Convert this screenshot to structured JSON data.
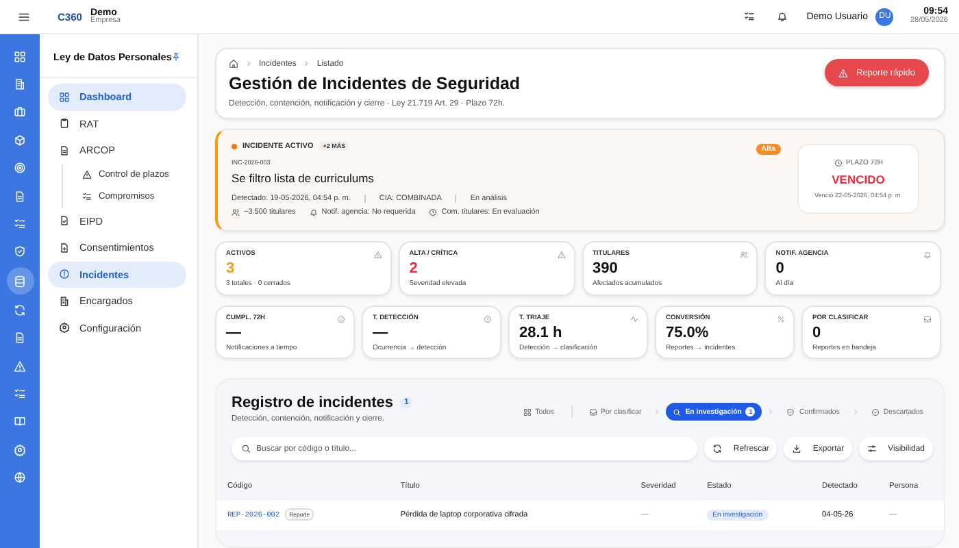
{
  "topbar": {
    "logo": "C360",
    "company": "Demo",
    "company_sub": "Empresa",
    "user": "Demo Usuario",
    "avatar": "DU",
    "time": "09:54",
    "date": "28/05/2026"
  },
  "rail": [
    {
      "selected": false
    },
    {
      "selected": false
    },
    {
      "selected": false
    },
    {
      "selected": false
    },
    {
      "selected": false
    },
    {
      "selected": false
    },
    {
      "selected": false
    },
    {
      "selected": false
    },
    {
      "selected": true
    },
    {
      "selected": false
    },
    {
      "selected": false
    },
    {
      "selected": false
    },
    {
      "selected": false
    },
    {
      "selected": false
    },
    {
      "selected": false
    },
    {
      "selected": false
    }
  ],
  "sidebar": {
    "title": "Ley de Datos Personales",
    "items": [
      {
        "label": "Dashboard",
        "selected": true
      },
      {
        "label": "RAT",
        "selected": false
      },
      {
        "label": "ARCOP",
        "selected": false,
        "children": [
          {
            "label": "Control de plazos",
            "selected": false
          },
          {
            "label": "Compromisos",
            "selected": false
          }
        ]
      },
      {
        "label": "EIPD",
        "selected": false
      },
      {
        "label": "Consentimientos",
        "selected": false
      },
      {
        "label": "Incidentes",
        "selected": true
      },
      {
        "label": "Encargados",
        "selected": false
      },
      {
        "label": "Configuración",
        "selected": false
      }
    ]
  },
  "header": {
    "breadcrumb": [
      "Incidentes",
      "Listado"
    ],
    "title": "Gestión de Incidentes de Seguridad",
    "subtitle": "Detección, contención, notificación y cierre · Ley 21.719 Art. 29 · Plazo 72h.",
    "action": "Reporte rápido"
  },
  "incident": {
    "status": "INCIDENTE ACTIVO",
    "more": "+2 MÁS",
    "code": "INC-2026-003",
    "title": "Se filtro lista de curriculums",
    "meta": [
      "Detectado: 19-05-2026, 04:54 p. m.",
      "CIA: COMBINADA",
      "En análisis"
    ],
    "facts": [
      "~3.500 titulares",
      "Notif. agencia: No requerida",
      "Com. titulares: En evaluación"
    ],
    "severity": "Alta",
    "deadline": {
      "label": "PLAZO 72H",
      "state": "VENCIDO",
      "note": "Venció 22-05-2026, 04:54 p. m."
    }
  },
  "stats": [
    {
      "label": "ACTIVOS",
      "value": "3",
      "note": "3 totales · 0 cerrados",
      "color": "#f59e0b"
    },
    {
      "label": "ALTA / CRÍTICA",
      "value": "2",
      "note": "Severidad elevada",
      "color": "#ef2b3c"
    },
    {
      "label": "TITULARES",
      "value": "390",
      "note": "Afectados acumulados",
      "color": "#111111"
    },
    {
      "label": "NOTIF. AGENCIA",
      "value": "0",
      "note": "Al día",
      "color": "#111111"
    },
    {
      "label": "CUMPL. 72H",
      "value": "—",
      "note": "Notificaciones a tiempo",
      "color": "#111111"
    },
    {
      "label": "T. DETECCIÓN",
      "value": "—",
      "note": "Ocurrencia → detección",
      "color": "#111111"
    },
    {
      "label": "T. TRIAJE",
      "value": "28.1 h",
      "note": "Detección → clasificación",
      "color": "#111111"
    },
    {
      "label": "CONVERSIÓN",
      "value": "75.0%",
      "note": "Reportes → incidentes",
      "color": "#111111"
    },
    {
      "label": "POR CLASIFICAR",
      "value": "0",
      "note": "Reportes en bandeja",
      "color": "#111111"
    }
  ],
  "registry": {
    "title": "Registro de incidentes",
    "count": "1",
    "subtitle": "Detección, contención, notificación y cierre.",
    "filters": [
      {
        "label": "Todos",
        "selected": false
      },
      {
        "label": "Por clasificar",
        "selected": false
      },
      {
        "label": "En investigación",
        "count": "1",
        "selected": true
      },
      {
        "label": "Confirmados",
        "selected": false
      },
      {
        "label": "Descartados",
        "selected": false
      }
    ],
    "search": {
      "placeholder": "Buscar por código o título..."
    },
    "buttons": [
      "Refrescar",
      "Exportar",
      "Visibilidad"
    ],
    "table": {
      "columns": [
        "Código",
        "Título",
        "Severidad",
        "Estado",
        "Detectado",
        "Persona"
      ],
      "rows": [
        {
          "code": "REP-2026-002",
          "tag": "Reporte",
          "title": "Pérdida de laptop corporativa cifrada",
          "severity": "—",
          "status": "En investigación",
          "detected": "04-05-26",
          "person": "—"
        }
      ]
    }
  }
}
